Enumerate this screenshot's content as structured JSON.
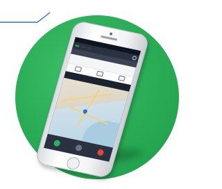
{
  "colors": {
    "disc": "#2bae57",
    "connector": "#2a6ee0",
    "phone_body": "#f3f4f6",
    "app_accent": "#27b45a",
    "app_dark": "#2a3140"
  },
  "device": {
    "type": "smartphone",
    "screen": {
      "status_text": "",
      "tabs": [
        {
          "label": "",
          "active": true
        },
        {
          "label": "",
          "active": false
        },
        {
          "label": "",
          "active": false
        }
      ],
      "panel_title": "",
      "info_rows": [
        {
          "label": "",
          "value": ""
        },
        {
          "label": "",
          "value": ""
        }
      ],
      "actions": [
        {
          "label": "",
          "icon": "video-icon"
        },
        {
          "label": "",
          "icon": "location-icon"
        },
        {
          "label": "",
          "icon": "car-icon"
        }
      ],
      "map_icon": "map-pin-icon",
      "nav_buttons": [
        "call-button",
        "stop-button",
        "back-button"
      ]
    }
  }
}
